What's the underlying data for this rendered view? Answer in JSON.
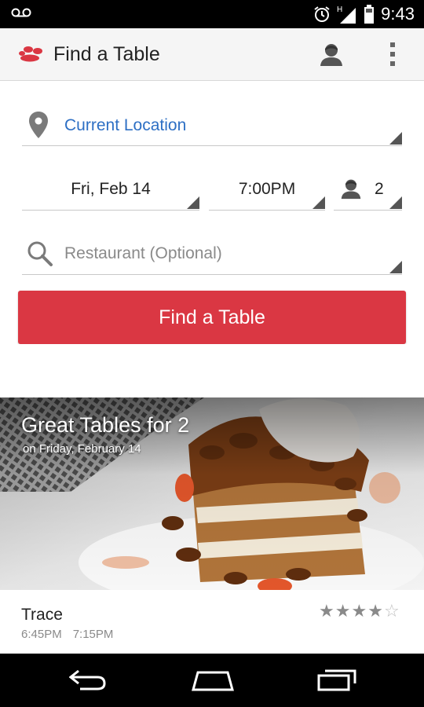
{
  "status_bar": {
    "time": "9:43",
    "network": "H"
  },
  "app_bar": {
    "title": "Find a Table"
  },
  "search": {
    "location": "Current Location",
    "date": "Fri, Feb 14",
    "time": "7:00PM",
    "party_size": "2",
    "restaurant_placeholder": "Restaurant (Optional)",
    "find_button": "Find a Table"
  },
  "promo": {
    "headline": "Great Tables for 2",
    "subtitle": "on Friday, February 14"
  },
  "listing": {
    "name": "Trace",
    "times": [
      "6:45PM",
      "7:15PM"
    ],
    "rating": 4,
    "rating_max": 5
  },
  "colors": {
    "brand_red": "#da3743",
    "link_blue": "#2d6fc4"
  }
}
